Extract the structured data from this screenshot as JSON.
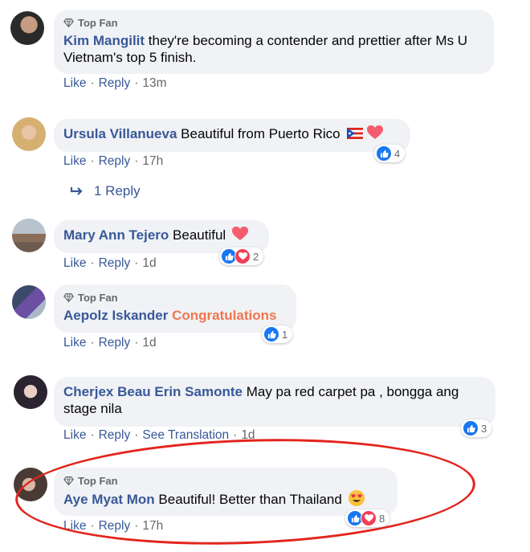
{
  "comments": [
    {
      "badge": "Top Fan",
      "author": "Kim Mangilit",
      "text": "they're becoming a contender and prettier after Ms U Vietnam's top 5 finish.",
      "like": "Like",
      "reply": "Reply",
      "time": "13m"
    },
    {
      "author": "Ursula Villanueva",
      "text": "Beautiful from Puerto Rico",
      "like": "Like",
      "reply": "Reply",
      "time": "17h",
      "reactions": "4"
    },
    {
      "author": "Mary Ann Tejero",
      "text": "Beautiful",
      "like": "Like",
      "reply": "Reply",
      "time": "1d",
      "reactions": "2"
    },
    {
      "badge": "Top Fan",
      "author": "Aepolz Iskander",
      "text": "Congratulations",
      "like": "Like",
      "reply": "Reply",
      "time": "1d",
      "reactions": "1"
    },
    {
      "author": "Cherjex Beau Erin Samonte",
      "text": "May pa red carpet pa , bongga ang stage nila",
      "like": "Like",
      "reply": "Reply",
      "see_translation": "See Translation",
      "time": "1d",
      "reactions": "3"
    },
    {
      "badge": "Top Fan",
      "author": "Aye Myat Mon",
      "text": "Beautiful! Better than Thailand",
      "like": "Like",
      "reply": "Reply",
      "time": "17h",
      "reactions": "8"
    }
  ],
  "replies_link": "1 Reply",
  "separator": "·"
}
